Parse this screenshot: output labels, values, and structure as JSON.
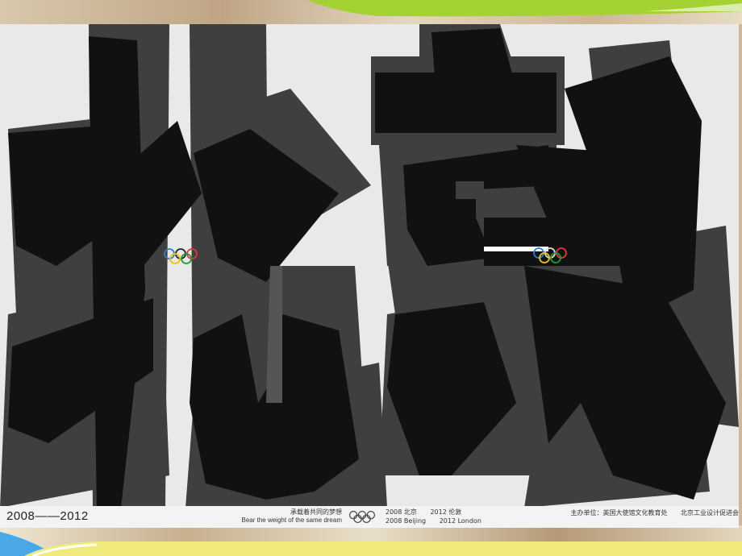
{
  "poster": {
    "years": "2008——2012",
    "slogan_cn": "承载着共同的梦想",
    "slogan_en": "Bear the weight of the same dream",
    "cities": {
      "row1_year": "2008",
      "row1_city": "北京",
      "row1_year2": "2012",
      "row1_city2": "伦敦",
      "row2_year": "2008",
      "row2_city": "Beijing",
      "row2_year2": "2012",
      "row2_city2": "London"
    },
    "organizer_label": "主办单位：英国大使馆文化教育处",
    "organizer_second": "北京工业设计促进会"
  },
  "colors": {
    "ink_dark": "#111111",
    "ink_mid": "#3f3f3f",
    "poster_bg": "#e9e9e9",
    "accent_green": "#a4d233",
    "accent_blue": "#4aa8e6",
    "accent_yellow": "#f0ea7a"
  },
  "icons": {
    "olympic_rings": "olympic-rings-icon"
  }
}
